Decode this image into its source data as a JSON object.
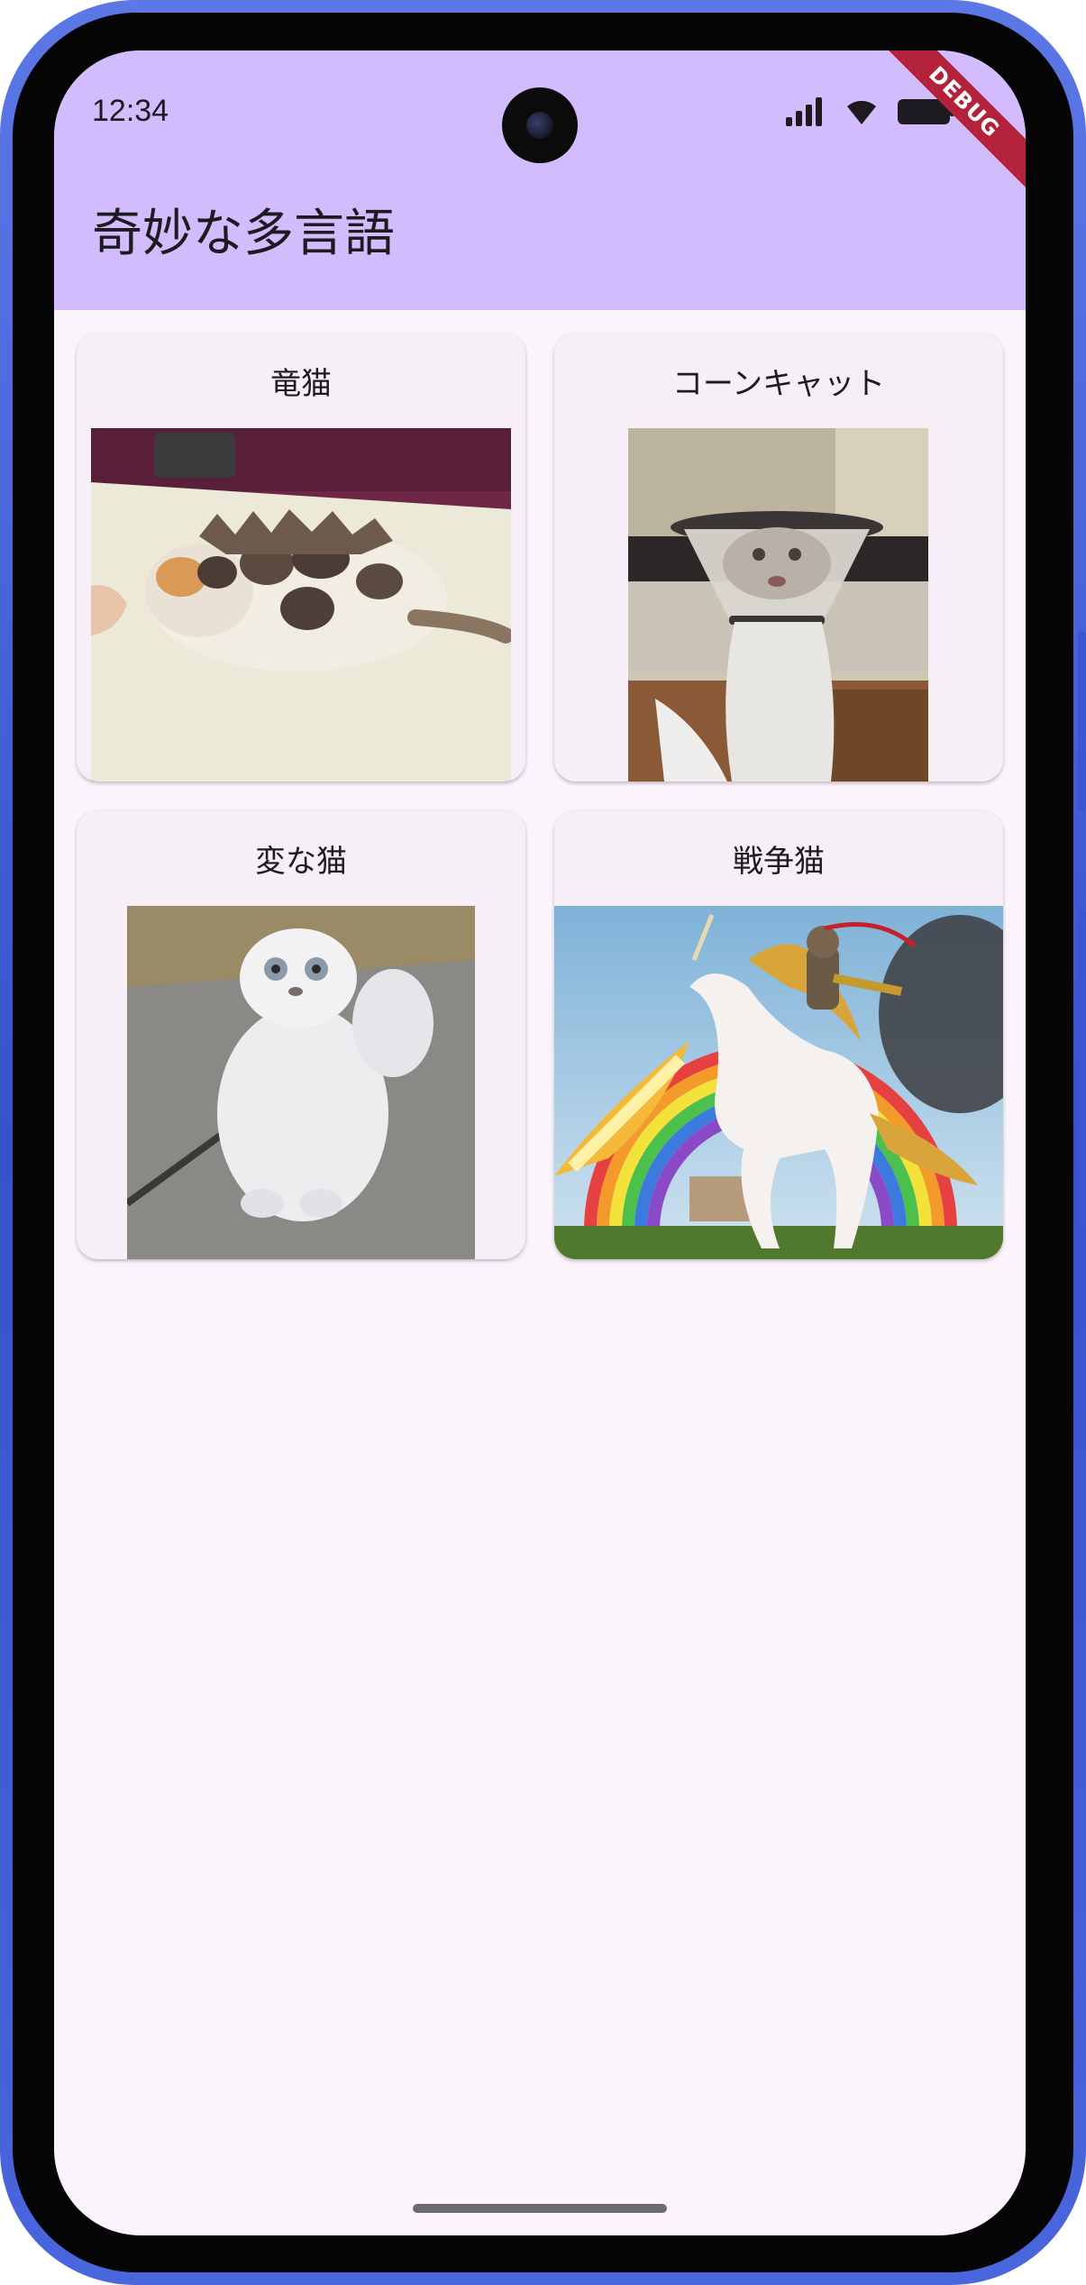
{
  "status_bar": {
    "time": "12:34",
    "icons": [
      "cellular-signal-icon",
      "wifi-icon",
      "battery-icon"
    ]
  },
  "app_bar": {
    "title": "奇妙な多言語",
    "background_color": "#d2bcfd"
  },
  "debug_banner": "DEBUG",
  "cards": [
    {
      "title": "竜猫",
      "image": "calico cat on towel with dragon spikes"
    },
    {
      "title": "コーンキャット",
      "image": "cat wearing a cone collar"
    },
    {
      "title": "変な猫",
      "image": "fluffy white cat with wide eyes"
    },
    {
      "title": "戦争猫",
      "image": "cat riding a unicorn over a rainbow"
    }
  ],
  "colors": {
    "screen_background": "#fcf4fc",
    "card_background": "#f6eff7",
    "phone_frame": "#3a56d3"
  }
}
